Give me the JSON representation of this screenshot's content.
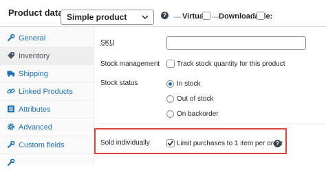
{
  "header": {
    "title": "Product data",
    "product_type_selected": "Simple product",
    "separator": "—",
    "virtual_label": "Virtual:",
    "downloadable_label": "Downloadable:",
    "help_glyph": "?"
  },
  "sidebar": {
    "items": [
      {
        "label": "General",
        "icon": "wrench-icon"
      },
      {
        "label": "Inventory",
        "icon": "tag-icon",
        "active": true
      },
      {
        "label": "Shipping",
        "icon": "truck-icon"
      },
      {
        "label": "Linked Products",
        "icon": "link-icon"
      },
      {
        "label": "Attributes",
        "icon": "list-icon"
      },
      {
        "label": "Advanced",
        "icon": "gear-icon"
      },
      {
        "label": "Custom fields",
        "icon": "wrench-icon"
      }
    ]
  },
  "inventory": {
    "sku_label": "SKU",
    "sku_value": "",
    "stock_management_label": "Stock management",
    "track_stock_label": "Track stock quantity for this product",
    "track_stock_checked": false,
    "stock_status_label": "Stock status",
    "stock_status_options": [
      "In stock",
      "Out of stock",
      "On backorder"
    ],
    "stock_status_selected": "In stock",
    "sold_individually_label": "Sold individually",
    "limit_purchases_label": "Limit purchases to 1 item per order",
    "limit_purchases_checked": true
  },
  "colors": {
    "link": "#2271b1",
    "highlight_border": "#e0433b",
    "text": "#1d2327"
  }
}
